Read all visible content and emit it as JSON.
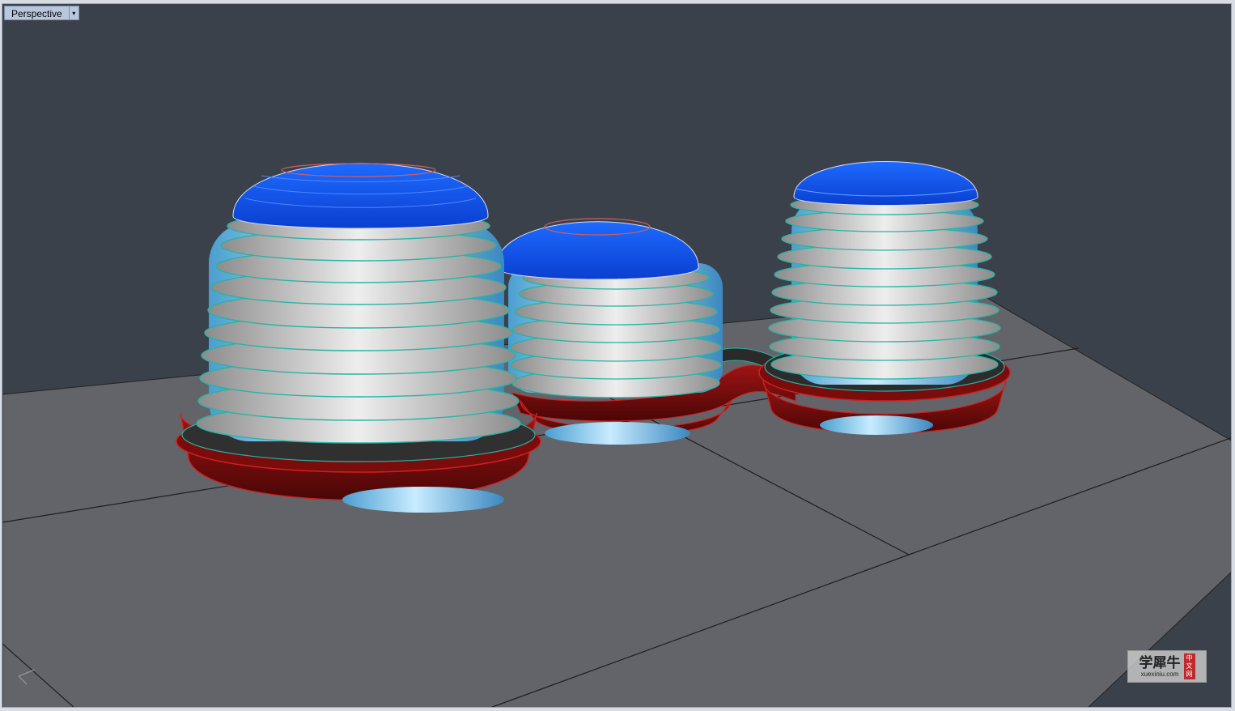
{
  "viewport": {
    "title": "Perspective",
    "menu_arrow": "▾"
  },
  "watermark": {
    "brand": "学犀牛",
    "url": "xuexiniu.com",
    "seal": "中文网"
  },
  "colors": {
    "background": "#3b414a",
    "ground": "#626469",
    "roof": "#0a5cff",
    "floor_slab": "#c8c8c8",
    "floor_edge": "#28b4a4",
    "glass": "#8cc8ea",
    "podium": "#7a0c0c"
  },
  "icons": {
    "axis_icon": "world-axis-icon",
    "dropdown": "chevron-down-icon"
  }
}
